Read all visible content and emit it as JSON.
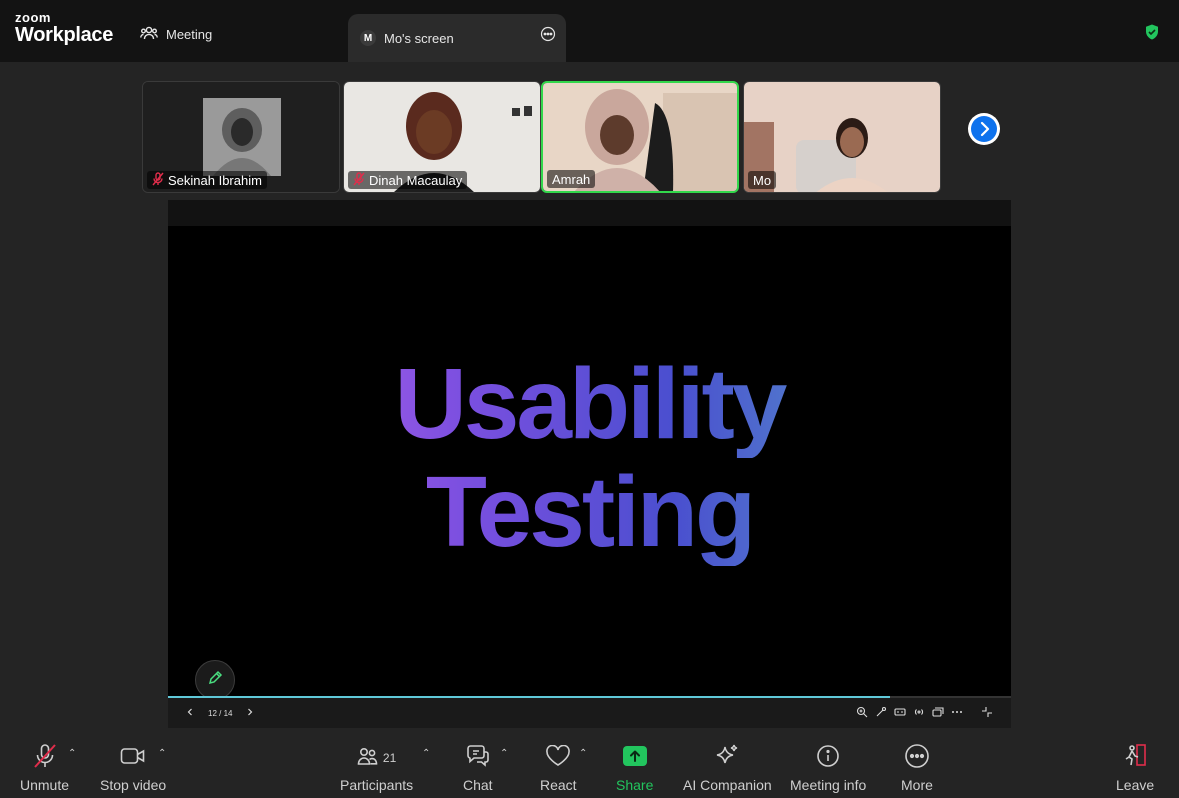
{
  "app": {
    "brand_small": "zoom",
    "brand_large": "Workplace"
  },
  "tabs": {
    "meeting": "Meeting",
    "screen": "Mo's screen",
    "screen_initial": "M"
  },
  "participants_strip": [
    {
      "name": "Sekinah Ibrahim",
      "muted": true
    },
    {
      "name": "Dinah Macaulay",
      "muted": true
    },
    {
      "name": "Amrah",
      "muted": false,
      "active": true
    },
    {
      "name": "Mo",
      "muted": false
    }
  ],
  "slide": {
    "line1": "Usability",
    "line2": "Testing",
    "page_indicator": "12 / 14",
    "progress": 0.857
  },
  "toolbar": {
    "unmute": "Unmute",
    "stop_video": "Stop video",
    "participants": "Participants",
    "participants_count": "21",
    "chat": "Chat",
    "react": "React",
    "share": "Share",
    "ai_companion": "AI Companion",
    "meeting_info": "Meeting info",
    "more": "More",
    "leave": "Leave"
  },
  "colors": {
    "active_border": "#32d74b",
    "share_green": "#22c55e",
    "mute_red": "#e02d4b",
    "nav_blue": "#0e72ed"
  }
}
